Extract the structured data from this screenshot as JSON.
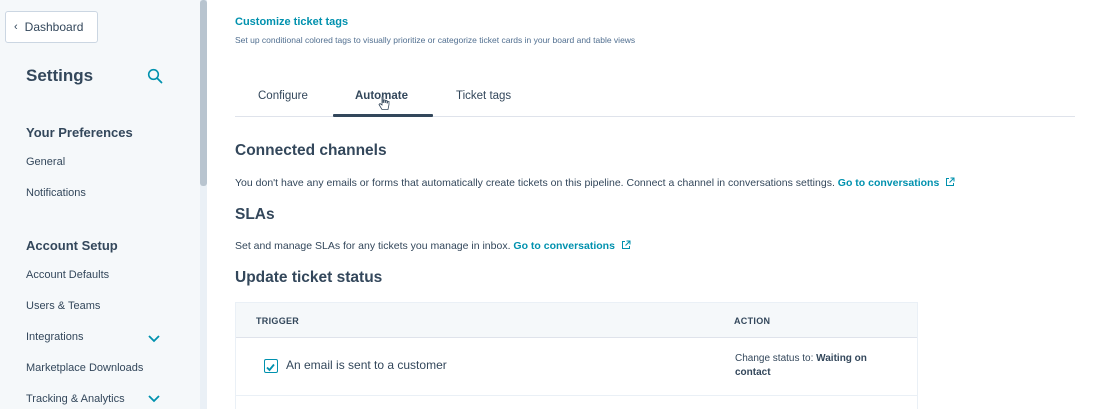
{
  "sidebar": {
    "back_button": "Dashboard",
    "title": "Settings",
    "sections": [
      {
        "heading": "Your Preferences",
        "items": [
          {
            "label": "General"
          },
          {
            "label": "Notifications"
          }
        ]
      },
      {
        "heading": "Account Setup",
        "items": [
          {
            "label": "Account Defaults"
          },
          {
            "label": "Users & Teams"
          },
          {
            "label": "Integrations",
            "expandable": true
          },
          {
            "label": "Marketplace Downloads"
          },
          {
            "label": "Tracking & Analytics",
            "expandable": true
          }
        ]
      }
    ]
  },
  "main": {
    "customize": {
      "link": "Customize ticket tags",
      "description": "Set up conditional colored tags to visually prioritize or categorize ticket cards in your board and table views"
    },
    "tabs": [
      {
        "label": "Configure",
        "active": false
      },
      {
        "label": "Automate",
        "active": true
      },
      {
        "label": "Ticket tags",
        "active": false
      }
    ],
    "connected_channels": {
      "heading": "Connected channels",
      "text": "You don't have any emails or forms that automatically create tickets on this pipeline. Connect a channel in conversations settings.",
      "link": "Go to conversations"
    },
    "slas": {
      "heading": "SLAs",
      "text": "Set and manage SLAs for any tickets you manage in inbox.",
      "link": "Go to conversations"
    },
    "update_status": {
      "heading": "Update ticket status",
      "columns": [
        "TRIGGER",
        "ACTION"
      ],
      "rows": [
        {
          "trigger": "An email is sent to a customer",
          "checked": true,
          "action_prefix": "Change status to:",
          "action_value": "Waiting on contact"
        }
      ]
    }
  },
  "colors": {
    "accent": "#0091ae",
    "text": "#33475b",
    "sidebar_bg": "#f5f8fa"
  }
}
